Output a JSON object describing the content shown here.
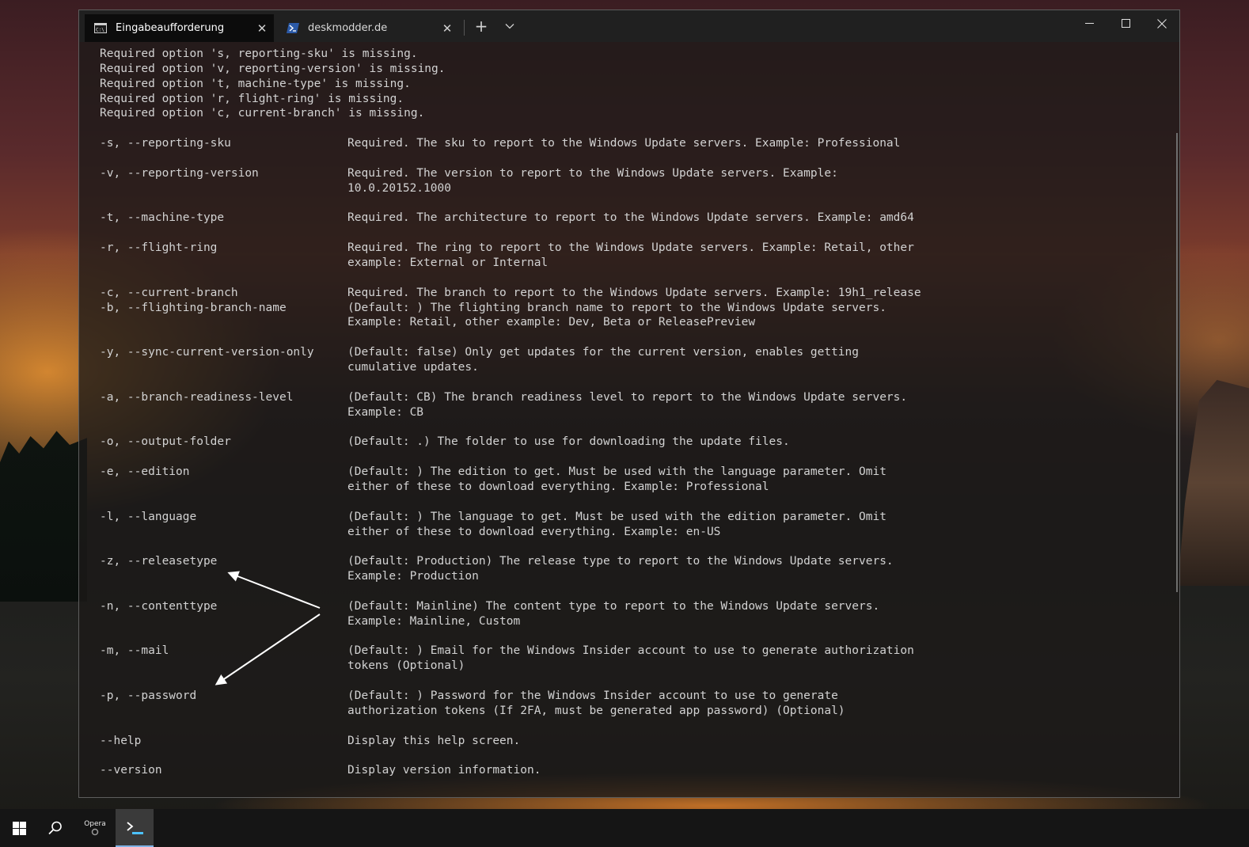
{
  "window": {
    "tabs": [
      {
        "label": "Eingabeaufforderung",
        "icon": "cmd-icon",
        "active": true
      },
      {
        "label": "deskmodder.de",
        "icon": "powershell-icon",
        "active": false
      }
    ],
    "new_tab_glyph": "+",
    "dropdown_glyph": "⌄",
    "close_glyph": "✕"
  },
  "terminal": {
    "text_color": "#d2d2d2",
    "errors": [
      "Required option 's, reporting-sku' is missing.",
      "Required option 'v, reporting-version' is missing.",
      "Required option 't, machine-type' is missing.",
      "Required option 'r, flight-ring' is missing.",
      "Required option 'c, current-branch' is missing."
    ],
    "help_rows": [
      {
        "opt": "-s, --reporting-sku",
        "desc": "Required. The sku to report to the Windows Update servers. Example: Professional"
      },
      {
        "opt": "",
        "desc": ""
      },
      {
        "opt": "-v, --reporting-version",
        "desc": "Required. The version to report to the Windows Update servers. Example:"
      },
      {
        "opt": "",
        "desc": "10.0.20152.1000"
      },
      {
        "opt": "",
        "desc": ""
      },
      {
        "opt": "-t, --machine-type",
        "desc": "Required. The architecture to report to the Windows Update servers. Example: amd64"
      },
      {
        "opt": "",
        "desc": ""
      },
      {
        "opt": "-r, --flight-ring",
        "desc": "Required. The ring to report to the Windows Update servers. Example: Retail, other"
      },
      {
        "opt": "",
        "desc": "example: External or Internal"
      },
      {
        "opt": "",
        "desc": ""
      },
      {
        "opt": "-c, --current-branch",
        "desc": "Required. The branch to report to the Windows Update servers. Example: 19h1_release"
      },
      {
        "opt": "-b, --flighting-branch-name",
        "desc": "(Default: ) The flighting branch name to report to the Windows Update servers."
      },
      {
        "opt": "",
        "desc": "Example: Retail, other example: Dev, Beta or ReleasePreview"
      },
      {
        "opt": "",
        "desc": ""
      },
      {
        "opt": "-y, --sync-current-version-only",
        "desc": "(Default: false) Only get updates for the current version, enables getting"
      },
      {
        "opt": "",
        "desc": "cumulative updates."
      },
      {
        "opt": "",
        "desc": ""
      },
      {
        "opt": "-a, --branch-readiness-level",
        "desc": "(Default: CB) The branch readiness level to report to the Windows Update servers."
      },
      {
        "opt": "",
        "desc": "Example: CB"
      },
      {
        "opt": "",
        "desc": ""
      },
      {
        "opt": "-o, --output-folder",
        "desc": "(Default: .) The folder to use for downloading the update files."
      },
      {
        "opt": "",
        "desc": ""
      },
      {
        "opt": "-e, --edition",
        "desc": "(Default: ) The edition to get. Must be used with the language parameter. Omit"
      },
      {
        "opt": "",
        "desc": "either of these to download everything. Example: Professional"
      },
      {
        "opt": "",
        "desc": ""
      },
      {
        "opt": "-l, --language",
        "desc": "(Default: ) The language to get. Must be used with the edition parameter. Omit"
      },
      {
        "opt": "",
        "desc": "either of these to download everything. Example: en-US"
      },
      {
        "opt": "",
        "desc": ""
      },
      {
        "opt": "-z, --releasetype",
        "desc": "(Default: Production) The release type to report to the Windows Update servers."
      },
      {
        "opt": "",
        "desc": "Example: Production"
      },
      {
        "opt": "",
        "desc": ""
      },
      {
        "opt": "-n, --contenttype",
        "desc": "(Default: Mainline) The content type to report to the Windows Update servers."
      },
      {
        "opt": "",
        "desc": "Example: Mainline, Custom"
      },
      {
        "opt": "",
        "desc": ""
      },
      {
        "opt": "-m, --mail",
        "desc": "(Default: ) Email for the Windows Insider account to use to generate authorization"
      },
      {
        "opt": "",
        "desc": "tokens (Optional)"
      },
      {
        "opt": "",
        "desc": ""
      },
      {
        "opt": "-p, --password",
        "desc": "(Default: ) Password for the Windows Insider account to use to generate"
      },
      {
        "opt": "",
        "desc": "authorization tokens (If 2FA, must be generated app password) (Optional)"
      },
      {
        "opt": "",
        "desc": ""
      },
      {
        "opt": "--help",
        "desc": "Display this help screen."
      },
      {
        "opt": "",
        "desc": ""
      },
      {
        "opt": "--version",
        "desc": "Display version information."
      }
    ]
  },
  "annotation": {
    "color": "#ffffff"
  },
  "taskbar": {
    "items": [
      {
        "name": "start-button",
        "icon": "windows-logo-icon"
      },
      {
        "name": "search-button",
        "icon": "search-icon"
      },
      {
        "name": "opera-button",
        "label": "Opera",
        "icon": "opera-icon"
      },
      {
        "name": "terminal-button",
        "icon": "terminal-icon",
        "active": true
      }
    ],
    "opera_label": "Opera",
    "accent": "#7fb3e6"
  }
}
